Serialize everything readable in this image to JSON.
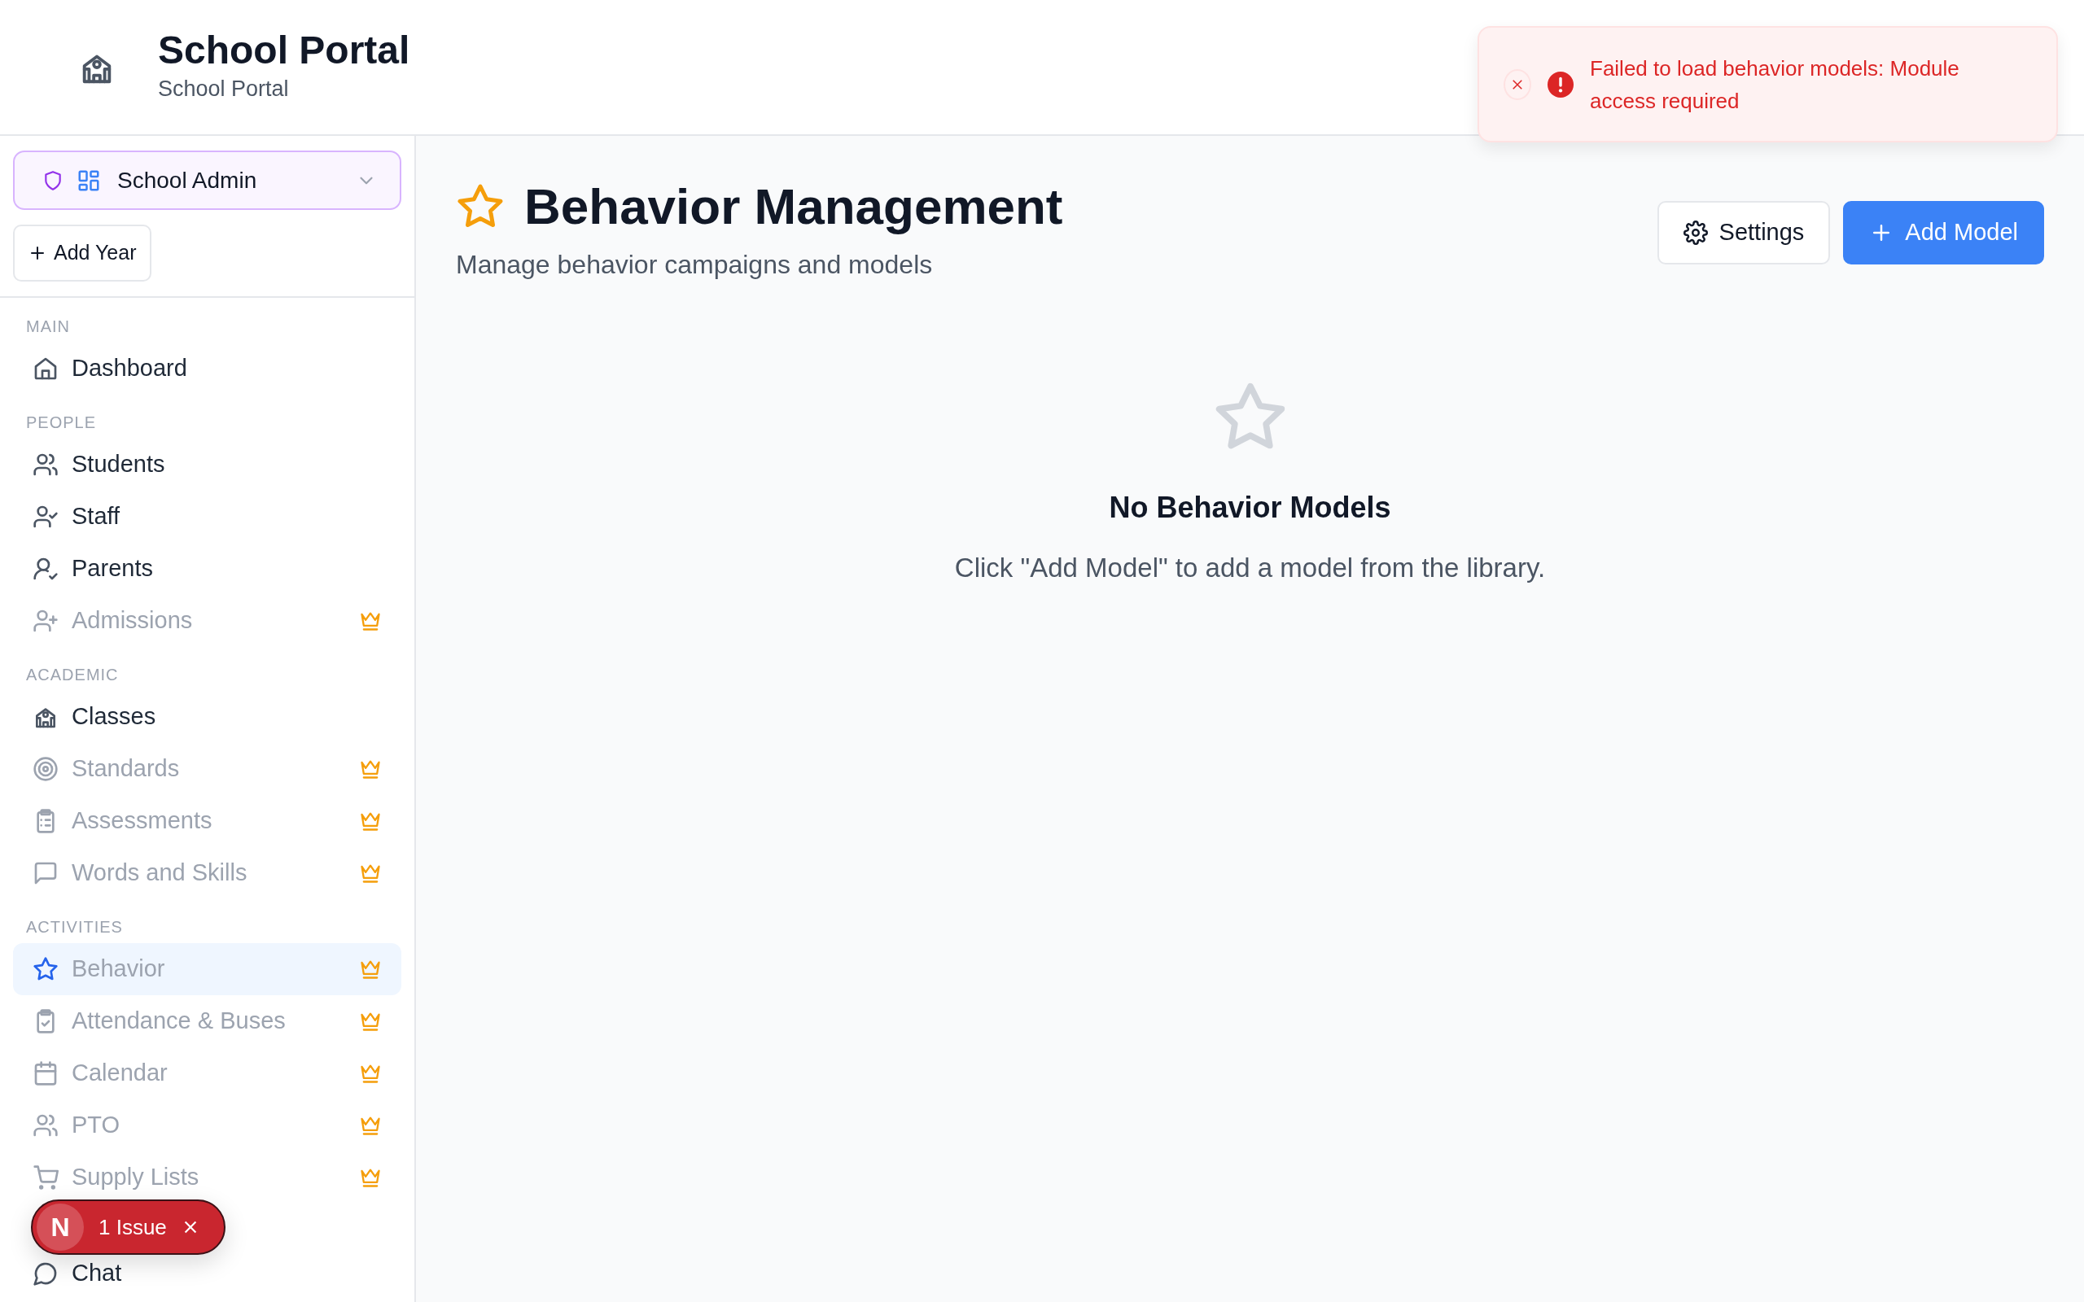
{
  "header": {
    "title": "School Portal",
    "subtitle": "School Portal"
  },
  "sidebar": {
    "role_selector": {
      "label": "School Admin"
    },
    "add_year_button": "Add Year",
    "sections": [
      {
        "label": "MAIN",
        "items": [
          {
            "label": "Dashboard",
            "locked": false,
            "selected": false
          }
        ]
      },
      {
        "label": "PEOPLE",
        "items": [
          {
            "label": "Students",
            "locked": false,
            "selected": false
          },
          {
            "label": "Staff",
            "locked": false,
            "selected": false
          },
          {
            "label": "Parents",
            "locked": false,
            "selected": false
          },
          {
            "label": "Admissions",
            "locked": true,
            "selected": false
          }
        ]
      },
      {
        "label": "ACADEMIC",
        "items": [
          {
            "label": "Classes",
            "locked": false,
            "selected": false
          },
          {
            "label": "Standards",
            "locked": true,
            "selected": false
          },
          {
            "label": "Assessments",
            "locked": true,
            "selected": false
          },
          {
            "label": "Words and Skills",
            "locked": true,
            "selected": false
          }
        ]
      },
      {
        "label": "ACTIVITIES",
        "items": [
          {
            "label": "Behavior",
            "locked": true,
            "selected": true
          },
          {
            "label": "Attendance & Buses",
            "locked": true,
            "selected": false
          },
          {
            "label": "Calendar",
            "locked": true,
            "selected": false
          },
          {
            "label": "PTO",
            "locked": true,
            "selected": false
          },
          {
            "label": "Supply Lists",
            "locked": true,
            "selected": false
          }
        ]
      },
      {
        "items": [
          {
            "label": "Chat",
            "locked": false,
            "selected": false
          }
        ]
      }
    ]
  },
  "page": {
    "title": "Behavior Management",
    "subtitle": "Manage behavior campaigns and models",
    "buttons": [
      {
        "label": "Settings",
        "kind": "secondary"
      },
      {
        "label": "Add Model",
        "kind": "primary"
      }
    ]
  },
  "empty_state": {
    "title": "No Behavior Models",
    "text": "Click \"Add Model\" to add a model from the library."
  },
  "toast": {
    "message": "Failed to load behavior models: Module access required"
  },
  "issue_badge": {
    "avatar": "N",
    "label": "1 Issue"
  }
}
